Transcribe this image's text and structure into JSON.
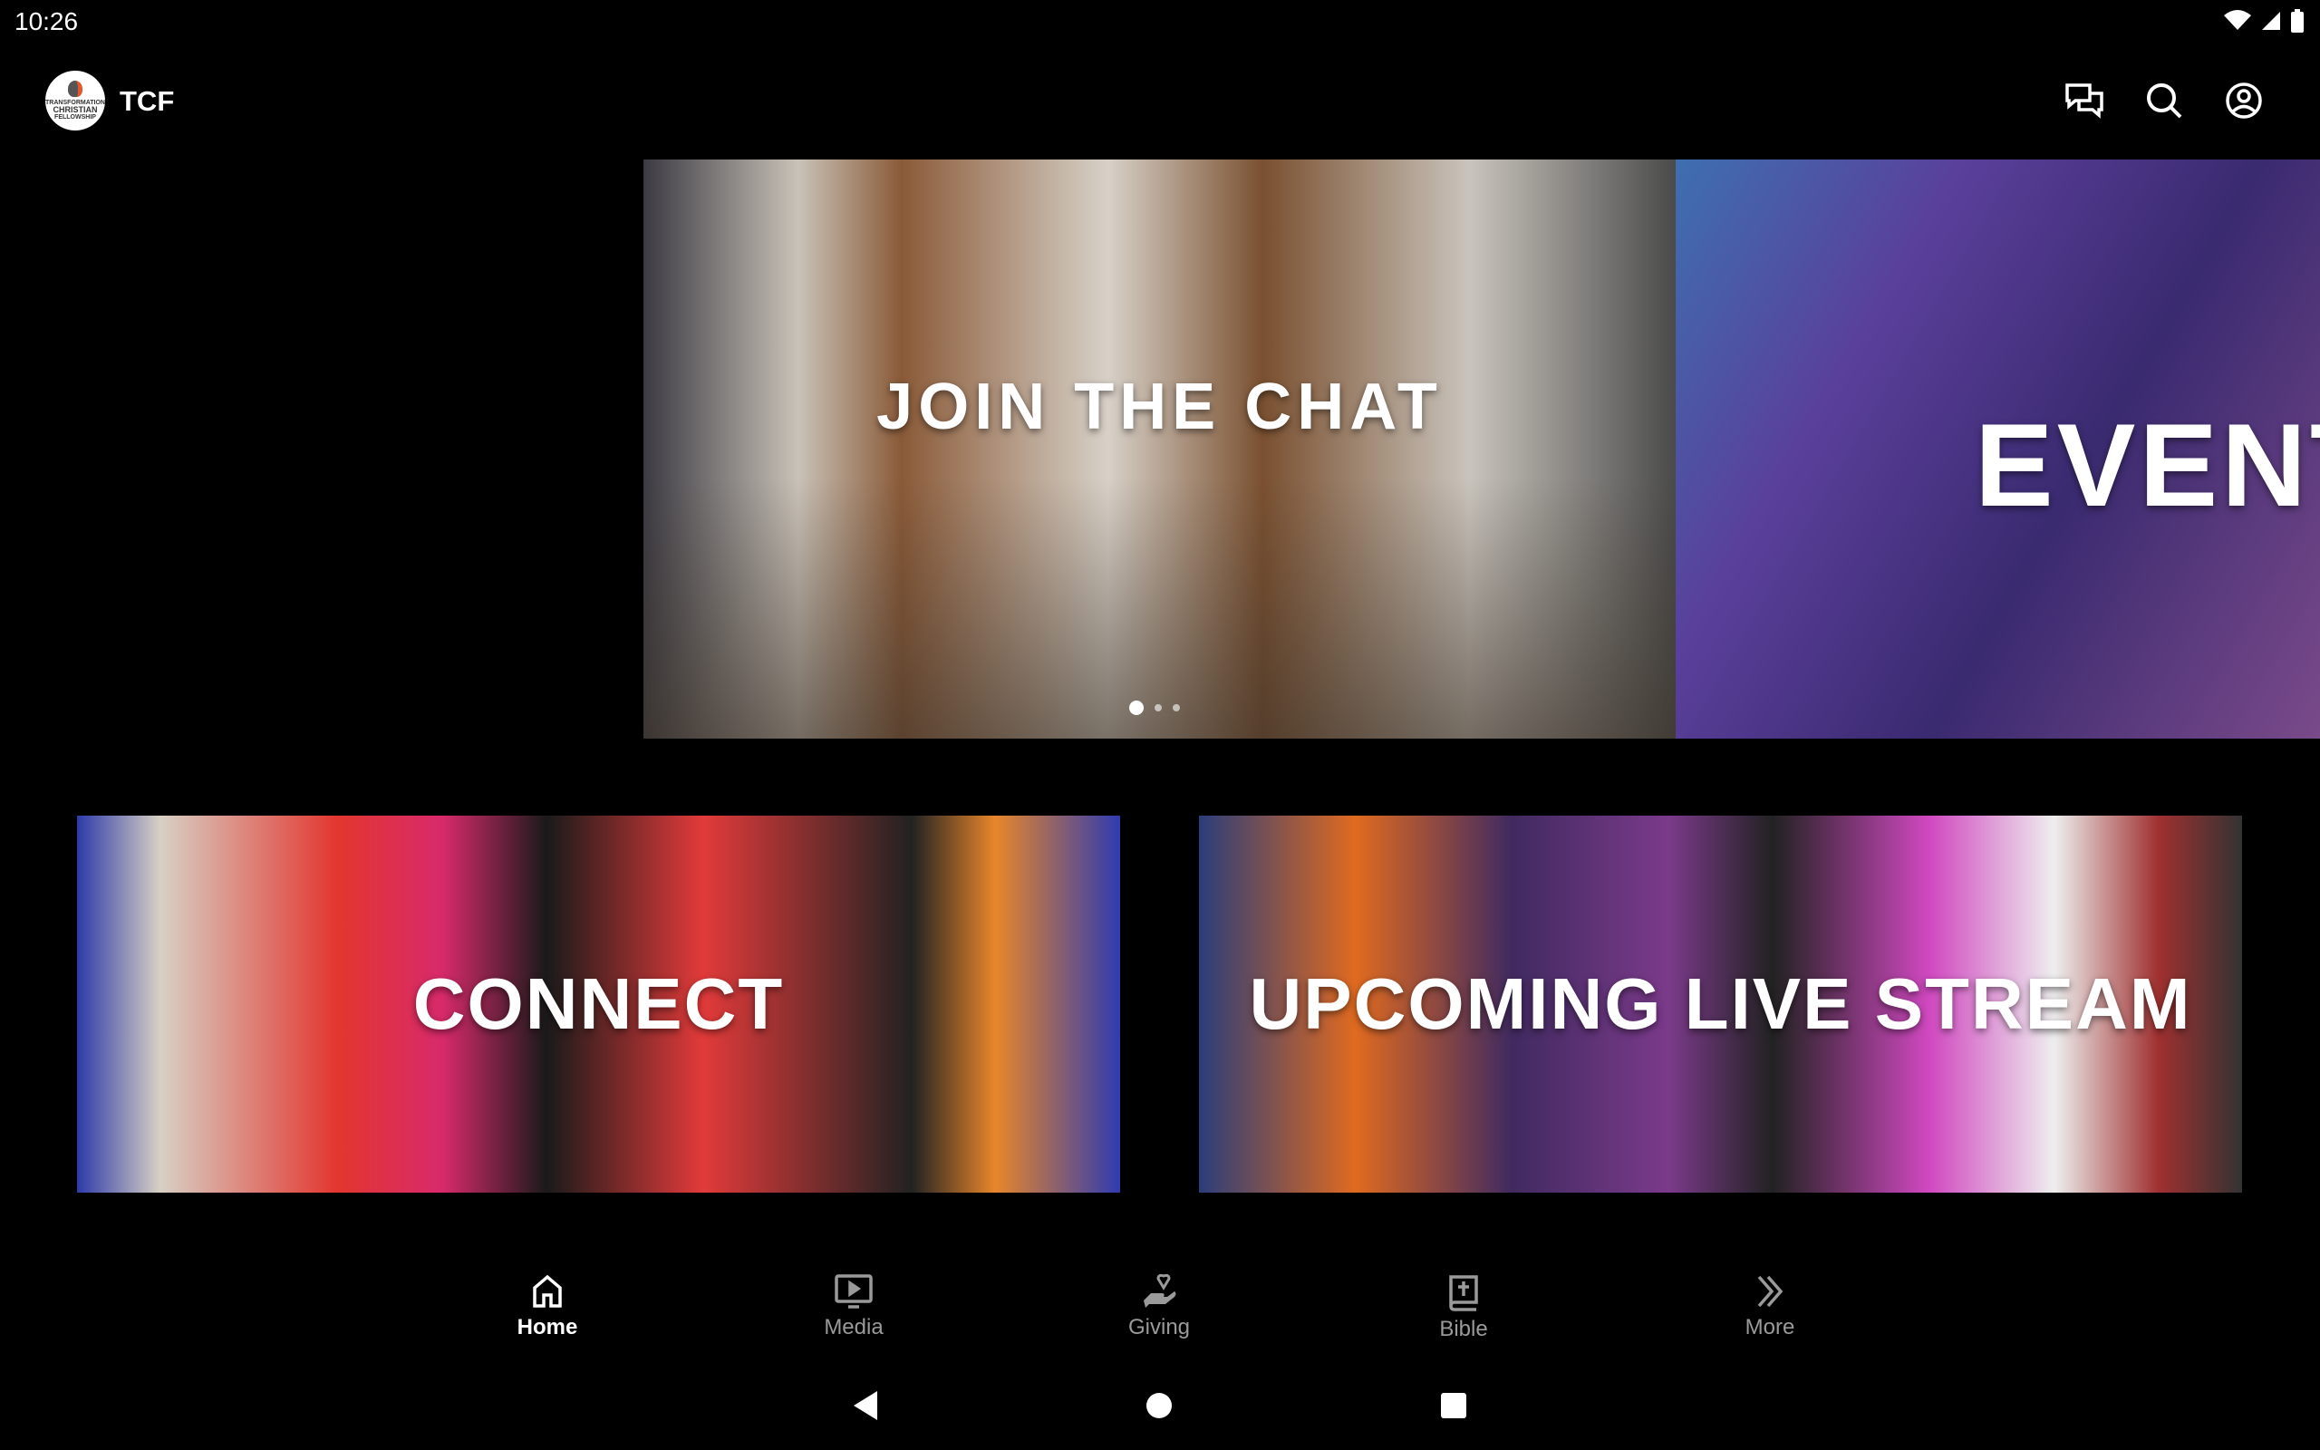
{
  "status_bar": {
    "time": "10:26"
  },
  "app_bar": {
    "logo_text": [
      "TRANSFORMATION",
      "CHRISTIAN",
      "FELLOWSHIP"
    ],
    "title": "TCF",
    "icons": [
      "chat-icon",
      "search-icon",
      "account-icon"
    ]
  },
  "carousel": {
    "slides": [
      {
        "title": "JOIN THE CHAT"
      },
      {
        "title": "EVENT"
      }
    ],
    "active_index": 0,
    "count": 3
  },
  "cards": [
    {
      "title": "CONNECT"
    },
    {
      "title": "UPCOMING LIVE STREAM"
    }
  ],
  "bottom_nav": {
    "items": [
      {
        "label": "Home",
        "icon": "home-icon",
        "active": true
      },
      {
        "label": "Media",
        "icon": "media-icon"
      },
      {
        "label": "Giving",
        "icon": "giving-icon"
      },
      {
        "label": "Bible",
        "icon": "bible-icon"
      },
      {
        "label": "More",
        "icon": "more-icon"
      }
    ]
  }
}
